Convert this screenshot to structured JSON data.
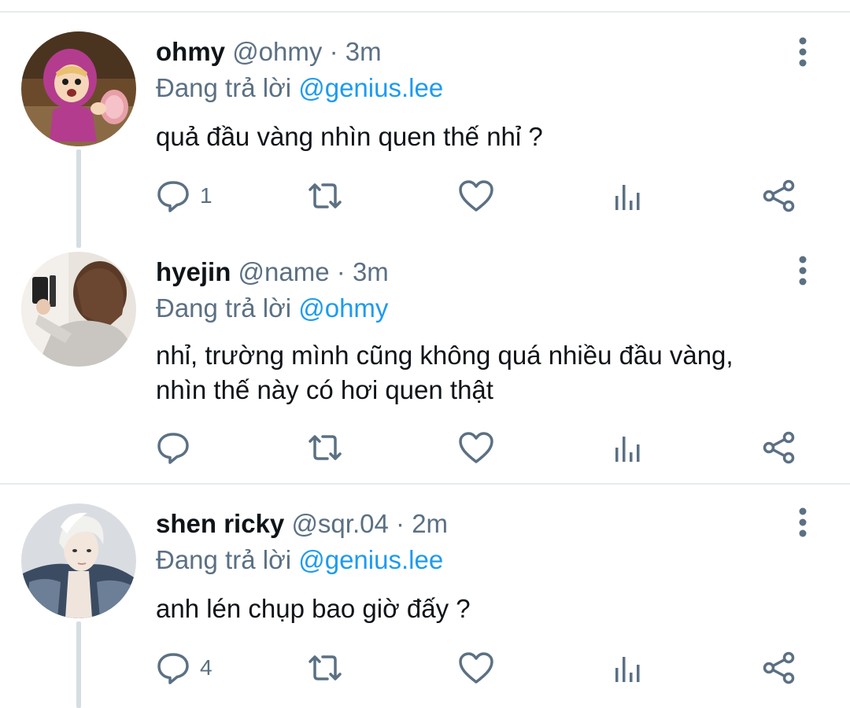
{
  "tweets": [
    {
      "name": "ohmy",
      "handle": "@ohmy",
      "dot": "·",
      "time": "3m",
      "reply_prefix": "Đang trả lời",
      "reply_to": "@genius.lee",
      "text": "quả đầu vàng nhìn quen thế nhỉ ?",
      "reply_count": "1",
      "avatar": "pink-hooded-cartoon-girl-avatar"
    },
    {
      "name": "hyejin",
      "handle": "@name",
      "dot": "·",
      "time": "3m",
      "reply_prefix": "Đang trả lời",
      "reply_to": "@ohmy",
      "text": "nhỉ, trường mình cũng không quá nhiều đầu vàng, nhìn thế này có hơi quen thật",
      "reply_count": "",
      "avatar": "mirror-selfie-woman-avatar"
    },
    {
      "name": "shen ricky",
      "handle": "@sqr.04",
      "dot": "·",
      "time": "2m",
      "reply_prefix": "Đang trả lời",
      "reply_to": "@genius.lee",
      "text": "anh lén chụp bao giờ đấy ?",
      "reply_count": "4",
      "avatar": "blond-man-portrait-avatar"
    }
  ],
  "icons": {
    "reply": "reply-icon",
    "retweet": "retweet-icon",
    "like": "like-icon",
    "analytics": "analytics-icon",
    "share": "share-icon",
    "more": "more-vertical-icon"
  },
  "colors": {
    "mention": "#1d9bf0",
    "secondary": "#5b7083",
    "divider": "#e6ecf0"
  }
}
